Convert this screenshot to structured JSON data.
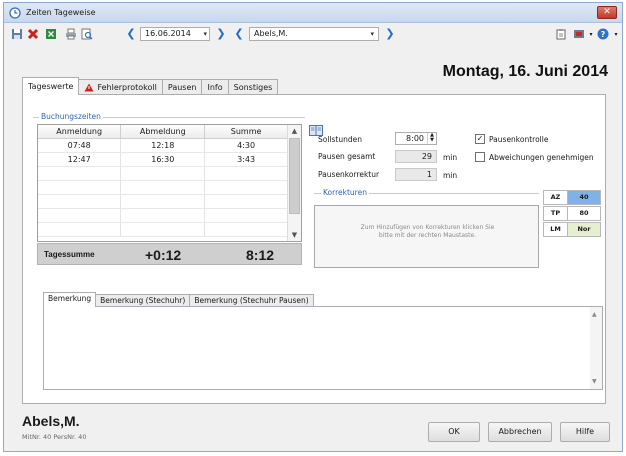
{
  "window": {
    "title": "Zeiten Tageweise"
  },
  "toolbar": {
    "date": "16.06.2014",
    "employee": "Abels,M."
  },
  "tabs": [
    {
      "label": "Tageswerte"
    },
    {
      "label": "Fehlerprotokoll"
    },
    {
      "label": "Pausen"
    },
    {
      "label": "Info"
    },
    {
      "label": "Sonstiges"
    }
  ],
  "header": {
    "date_title": "Montag, 16. Juni 2014"
  },
  "bookings": {
    "group_label": "Buchungszeiten",
    "columns": [
      "Anmeldung",
      "Abmeldung",
      "Summe"
    ],
    "rows": [
      [
        "07:48",
        "12:18",
        "4:30"
      ],
      [
        "12:47",
        "16:30",
        "3:43"
      ]
    ]
  },
  "summary": {
    "label": "Tagessumme",
    "difference": "+0:12",
    "total": "8:12"
  },
  "fields": {
    "sollstunden_label": "Sollstunden",
    "sollstunden_value": "8:00",
    "pausen_gesamt_label": "Pausen gesamt",
    "pausen_gesamt_value": "29",
    "pausenkorrektur_label": "Pausenkorrektur",
    "pausenkorrektur_value": "1",
    "unit_min": "min"
  },
  "checkboxes": {
    "pausenkontrolle_label": "Pausenkontrolle",
    "pausenkontrolle_checked": true,
    "abweichungen_label": "Abweichungen genehmigen",
    "abweichungen_checked": false
  },
  "corrections": {
    "group_label": "Korrekturen",
    "hint": "Zum Hinzufügen von Korrekturen klicken Sie bitte mit der rechten Maustaste."
  },
  "codes": [
    {
      "key": "AZ",
      "value": "40",
      "color": "#7fb2e8"
    },
    {
      "key": "TP",
      "value": "80",
      "color": "#ffffff"
    },
    {
      "key": "LM",
      "value": "Nor",
      "color": "#e6efcf"
    }
  ],
  "remarks": {
    "tabs": [
      "Bemerkung",
      "Bemerkung (Stechuhr)",
      "Bemerkung (Stechuhr Pausen)"
    ]
  },
  "footer": {
    "employee_name": "Abels,M.",
    "employee_info": "MitNr. 40  PersNr. 40",
    "ok_label": "OK",
    "cancel_label": "Abbrechen",
    "help_label": "Hilfe"
  }
}
